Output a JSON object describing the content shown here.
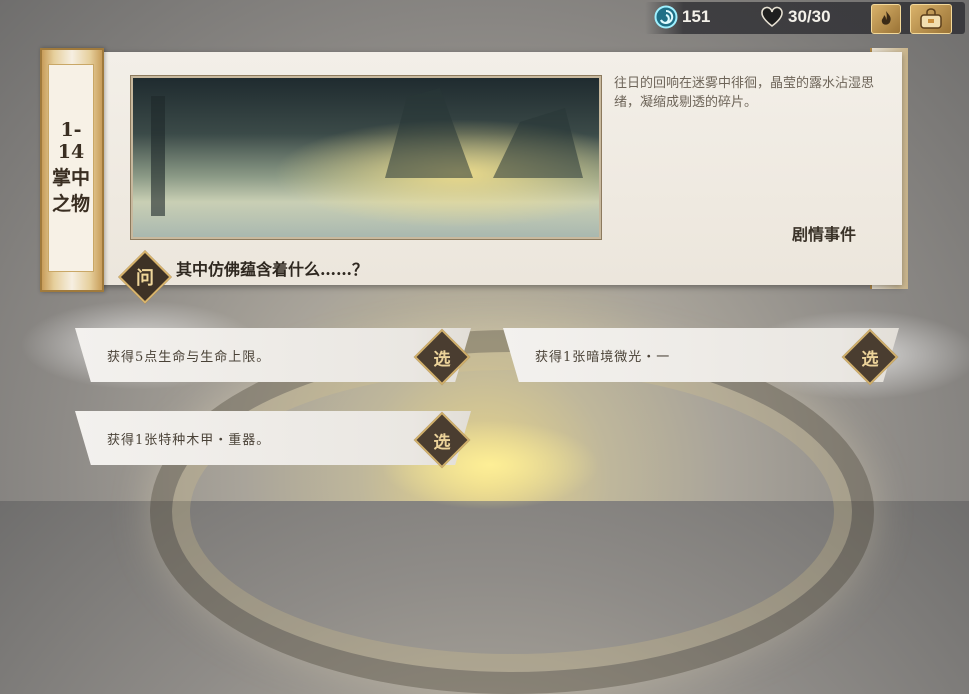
{
  "topbar": {
    "currency": {
      "icon": "swirl-coin-icon",
      "value": "151"
    },
    "health": {
      "icon": "heart-icon",
      "value": "30/30"
    },
    "buttons": [
      {
        "icon": "flame-emblem-icon"
      },
      {
        "icon": "bag-icon"
      }
    ]
  },
  "event": {
    "stage": "1-14",
    "name": "掌中之物",
    "description": "往日的回响在迷雾中徘徊，晶莹的露水沾湿思绪，凝缩成剔透的碎片。",
    "type": "剧情事件",
    "question_badge": "问",
    "question": "其中仿佛蕴含着什么……？"
  },
  "options": [
    {
      "text": "获得5点生命与生命上限。",
      "button": "选"
    },
    {
      "text": "获得1张暗境微光・一",
      "button": "选"
    },
    {
      "text": "获得1张特种木甲・重器。",
      "button": "选"
    }
  ],
  "colors": {
    "accent_gold": "#cfae6a",
    "badge_dark": "#4a3d30",
    "panel_bg": "#f3efe8"
  }
}
